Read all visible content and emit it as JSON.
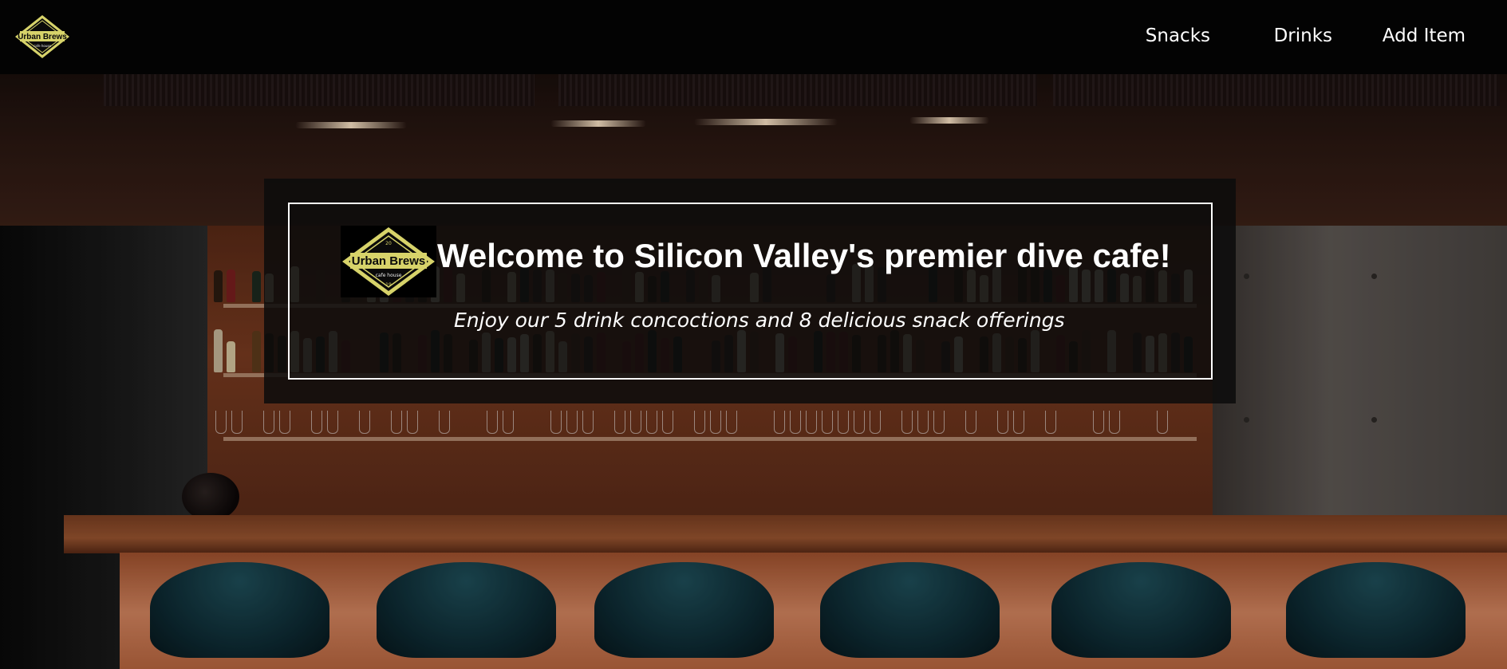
{
  "brand": {
    "name": "Urban Brews",
    "tagline": "cafe house",
    "badge_top": "20",
    "badge_bottom": "19",
    "logo_color": "#d7d36a"
  },
  "nav": {
    "items": [
      {
        "label": "Snacks"
      },
      {
        "label": "Drinks"
      },
      {
        "label": "Add Item"
      }
    ]
  },
  "hero": {
    "title": "Welcome to Silicon Valley's premier dive cafe!",
    "subtitle": "Enjoy our 5 drink concoctions and 8 delicious snack offerings"
  },
  "colors": {
    "navbar_bg": "#030303",
    "text": "#ffffff",
    "card_bg": "#0c0c0c"
  }
}
